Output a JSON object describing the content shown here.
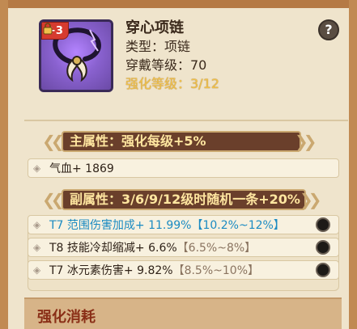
{
  "item": {
    "plus_level": "+3",
    "name": "穿心项链",
    "type_line": "类型：项链",
    "wear_level_line": "穿戴等级：70",
    "upgrade_line": "强化等级：3/12"
  },
  "help_label": "?",
  "main_attr": {
    "banner": "主属性：强化每级+5%",
    "rows": [
      {
        "text": "气血+ 1869"
      }
    ]
  },
  "sub_attr": {
    "banner": "副属性：3/6/9/12级时随机一条+20%",
    "rows": [
      {
        "main": "T7 范围伤害加成+ 11.99%",
        "range": "【10.2%~12%】",
        "highlight": true
      },
      {
        "main": "T8 技能冷却缩减+ 6.6%",
        "range": "【6.5%~8%】",
        "highlight": false
      },
      {
        "main": "T7 冰元素伤害+ 9.82%",
        "range": "【8.5%~10%】",
        "highlight": false
      }
    ]
  },
  "section": {
    "title": "强化消耗"
  },
  "colors": {
    "card_purple": "#7c5bb3",
    "banner_brown": "#6a3f2b",
    "banner_text": "#ffe6a0",
    "highlight_blue": "#1b8bc2"
  }
}
